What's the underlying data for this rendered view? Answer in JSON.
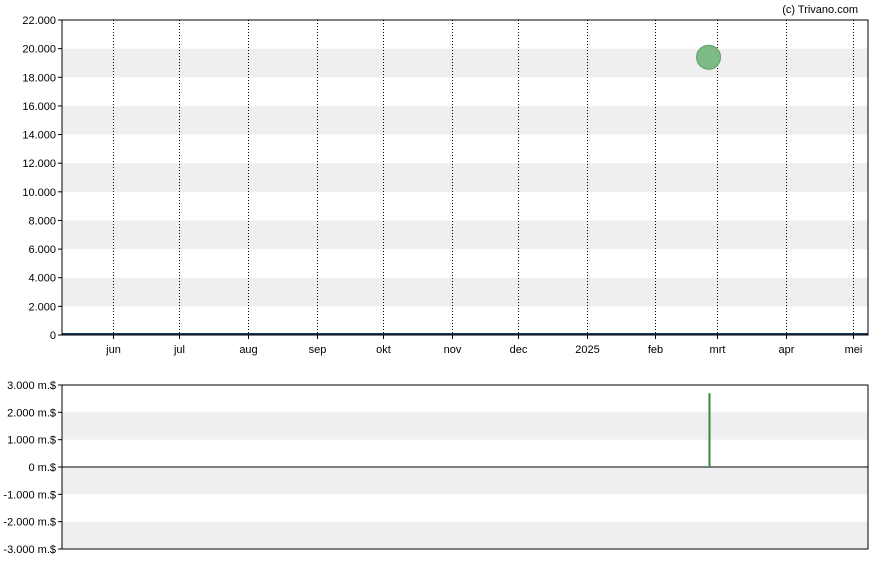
{
  "credit": "(c) Trivano.com",
  "chart_data": [
    {
      "type": "scatter",
      "title": "",
      "x_tick_labels": [
        "jun",
        "jul",
        "aug",
        "sep",
        "okt",
        "nov",
        "dec",
        "2025",
        "feb",
        "mrt",
        "apr",
        "mei"
      ],
      "x_tick_dates": [
        "2024-06-01",
        "2024-07-01",
        "2024-08-01",
        "2024-09-01",
        "2024-10-01",
        "2024-11-01",
        "2024-12-01",
        "2025-01-01",
        "2025-02-01",
        "2025-03-01",
        "2025-04-01",
        "2025-05-01"
      ],
      "xlim": [
        "2024-05-09",
        "2025-05-08"
      ],
      "ylim": [
        0,
        22000
      ],
      "y_ticks": [
        0,
        2000,
        4000,
        6000,
        8000,
        10000,
        12000,
        14000,
        16000,
        18000,
        20000,
        22000
      ],
      "y_tick_labels": [
        "0",
        "2.000",
        "4.000",
        "6.000",
        "8.000",
        "10.000",
        "12.000",
        "14.000",
        "16.000",
        "18.000",
        "20.000",
        "22.000"
      ],
      "grid": "vertical dotted, alternating horizontal bands",
      "series": [
        {
          "points": [
            {
              "x": "2025-02-25",
              "y": 19400
            }
          ],
          "color": "#7dba86"
        }
      ],
      "baseline_color": "#1a3a5c"
    },
    {
      "type": "bar",
      "ylim": [
        -3000,
        3000
      ],
      "y_ticks": [
        -3000,
        -2000,
        -1000,
        0,
        1000,
        2000,
        3000
      ],
      "y_tick_labels": [
        "-3.000 m.$",
        "-2.000 m.$",
        "-1.000 m.$",
        "0 m.$",
        "1.000 m.$",
        "2.000 m.$",
        "3.000 m.$"
      ],
      "series": [
        {
          "points": [
            {
              "x": "2025-02-25",
              "y": 2700
            }
          ],
          "color": "#2e8b3e"
        }
      ]
    }
  ]
}
